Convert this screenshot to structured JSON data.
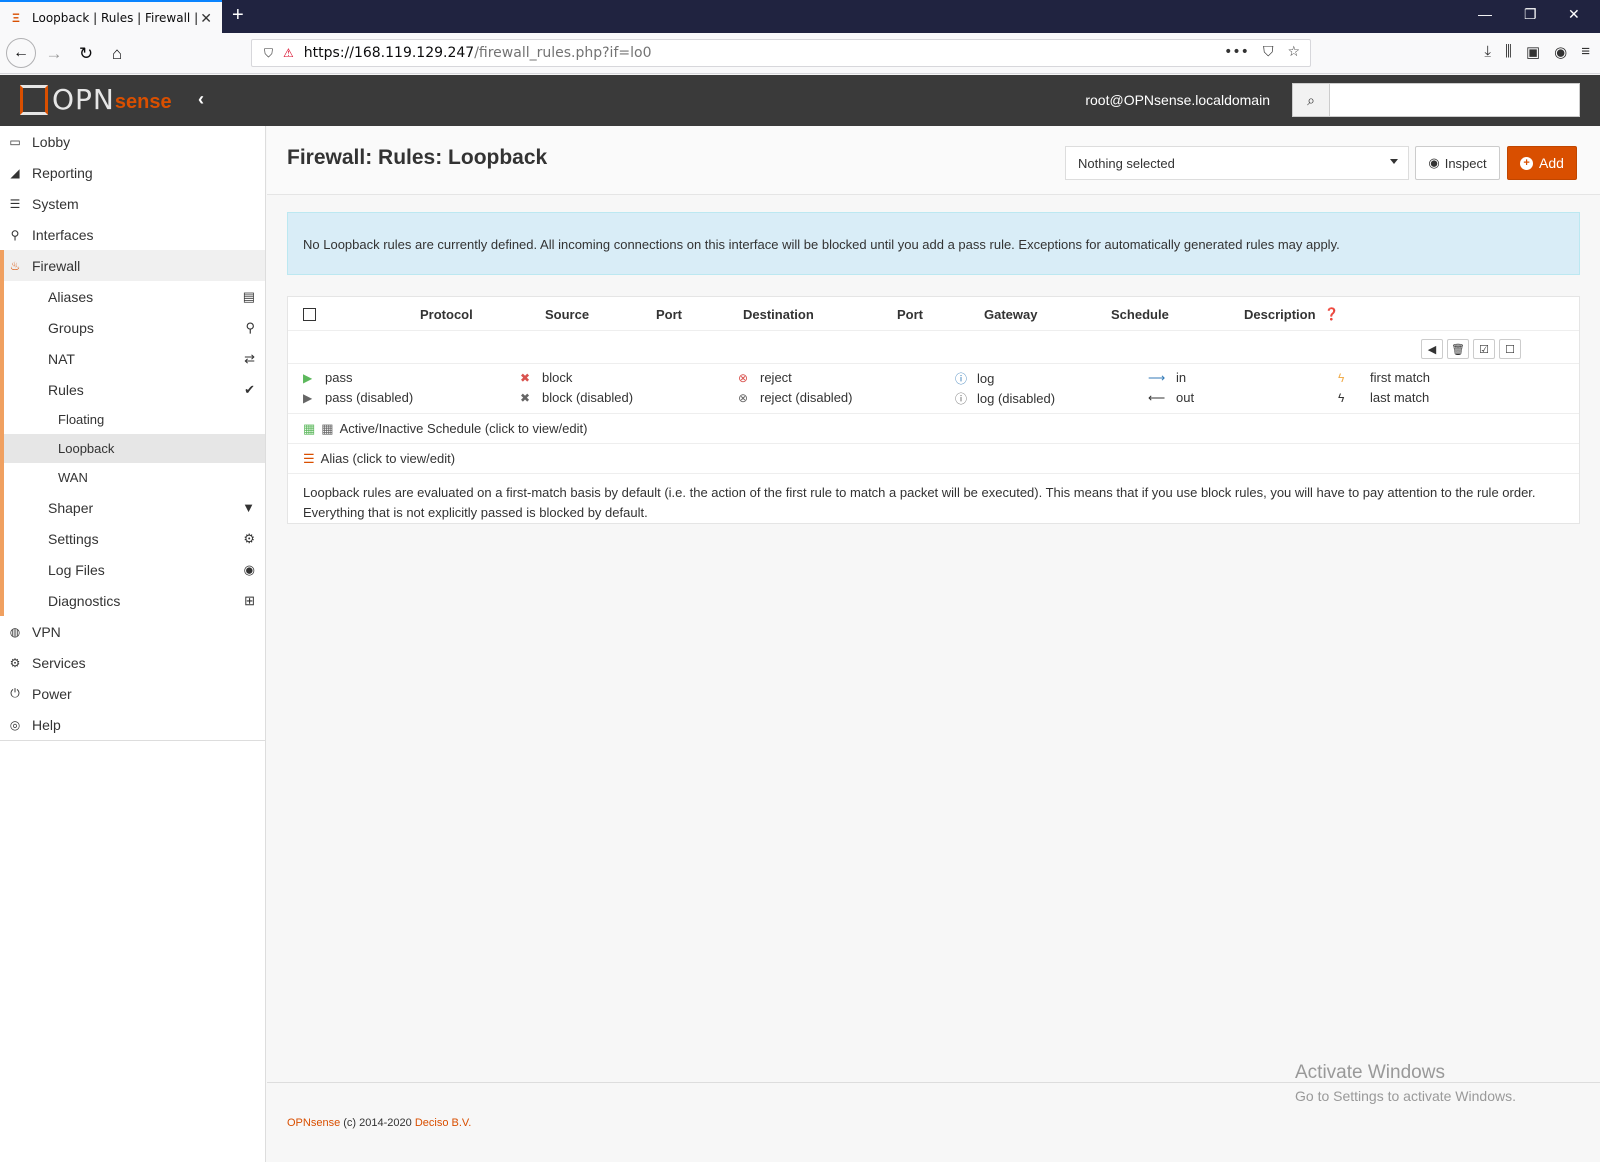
{
  "browser": {
    "tab_title": "Loopback | Rules | Firewall | OPNsense",
    "url_host": "https://168.119.129.247",
    "url_path": "/firewall_rules.php?if=lo0"
  },
  "header": {
    "logo_opn": "OPN",
    "logo_sense": "sense",
    "user": "root@OPNsense.localdomain",
    "search_placeholder": ""
  },
  "sidebar": {
    "top_items": [
      {
        "label": "Lobby",
        "icon": "laptop-icon"
      },
      {
        "label": "Reporting",
        "icon": "area-chart-icon"
      },
      {
        "label": "System",
        "icon": "server-icon"
      },
      {
        "label": "Interfaces",
        "icon": "sitemap-icon"
      },
      {
        "label": "Firewall",
        "icon": "fire-icon"
      }
    ],
    "firewall_items": [
      {
        "label": "Aliases",
        "icon": "list-icon"
      },
      {
        "label": "Groups",
        "icon": "sitemap-icon"
      },
      {
        "label": "NAT",
        "icon": "exchange-icon"
      },
      {
        "label": "Rules",
        "icon": "check-icon"
      }
    ],
    "rules_items": [
      "Floating",
      "Loopback",
      "WAN"
    ],
    "firewall_items_after": [
      {
        "label": "Shaper",
        "icon": "filter-icon"
      },
      {
        "label": "Settings",
        "icon": "cogs-icon"
      },
      {
        "label": "Log Files",
        "icon": "eye-icon"
      },
      {
        "label": "Diagnostics",
        "icon": "medkit-icon"
      }
    ],
    "bottom_items": [
      {
        "label": "VPN",
        "icon": "globe-icon"
      },
      {
        "label": "Services",
        "icon": "cog-icon"
      },
      {
        "label": "Power",
        "icon": "plug-icon"
      },
      {
        "label": "Help",
        "icon": "life-ring-icon"
      }
    ]
  },
  "page": {
    "title": "Firewall: Rules: Loopback",
    "select_value": "Nothing selected",
    "inspect_label": "Inspect",
    "add_label": "Add",
    "alert": "No Loopback rules are currently defined. All incoming connections on this interface will be blocked until you add a pass rule. Exceptions for automatically generated rules may apply."
  },
  "table": {
    "columns": [
      "Protocol",
      "Source",
      "Port",
      "Destination",
      "Port",
      "Gateway",
      "Schedule",
      "Description"
    ]
  },
  "legend": {
    "pass": "pass",
    "pass_disabled": "pass (disabled)",
    "block": "block",
    "block_disabled": "block (disabled)",
    "reject": "reject",
    "reject_disabled": "reject (disabled)",
    "log": "log",
    "log_disabled": "log (disabled)",
    "in": "in",
    "out": "out",
    "first_match": "first match",
    "last_match": "last match",
    "schedule": "Active/Inactive Schedule (click to view/edit)",
    "alias": "Alias (click to view/edit)"
  },
  "explanation": "Loopback rules are evaluated on a first-match basis by default (i.e. the action of the first rule to match a packet will be executed). This means that if you use block rules, you will have to pay attention to the rule order. Everything that is not explicitly passed is blocked by default.",
  "footer": {
    "brand": "OPNsense",
    "copyright": " (c) 2014-2020 ",
    "company": "Deciso B.V."
  },
  "watermark": {
    "title": "Activate Windows",
    "subtitle": "Go to Settings to activate Windows."
  },
  "colors": {
    "accent": "#d94f00",
    "header_bg": "#3a3a3a",
    "alert_bg": "#d9edf7"
  }
}
